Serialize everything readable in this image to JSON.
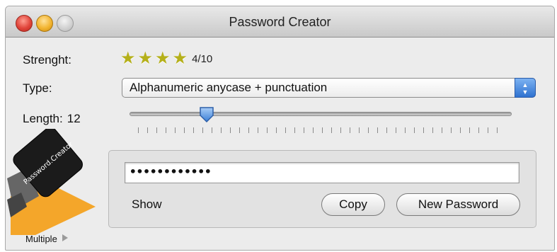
{
  "window": {
    "title": "Password Creator"
  },
  "strength": {
    "label": "Strenght:",
    "stars": 4,
    "score": "4/10"
  },
  "type": {
    "label": "Type:",
    "selected": "Alphanumeric anycase + punctuation"
  },
  "length": {
    "label": "Length:",
    "value": "12",
    "slider_fraction": 0.19
  },
  "logo": {
    "text": "Password.Creator"
  },
  "password": {
    "value": "••••••••••••"
  },
  "actions": {
    "show_label": "Show",
    "copy_label": "Copy",
    "new_password_label": "New Password"
  },
  "footer": {
    "multiple_label": "Multiple"
  },
  "colors": {
    "star": "#b5b01a",
    "accent_blue": "#2f72d0",
    "logo_orange": "#f4a62a"
  }
}
